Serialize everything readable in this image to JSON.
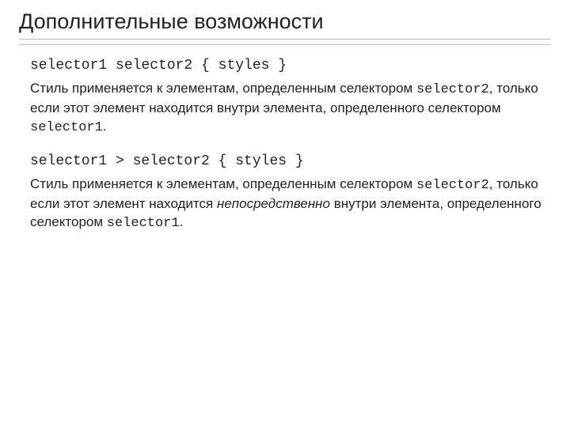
{
  "title": "Дополнительные возможности",
  "sections": [
    {
      "code": "selector1 selector2 { styles }",
      "text": {
        "prefix": "Стиль применяется к элементам, определенным селектором ",
        "sel2": "selector2",
        "mid": ", только если этот элемент находится внутри элемента, определенного селектором ",
        "italic_mid": "",
        "after_italic": "",
        "sel1": "selector1",
        "suffix": "."
      }
    },
    {
      "code": "selector1 > selector2 { styles }",
      "text": {
        "prefix": "Стиль применяется к элементам, определенным селектором ",
        "sel2": "selector2",
        "mid": ", только если этот элемент находится ",
        "italic_mid": "непосредственно",
        "after_italic": " внутри элемента, определенного селектором ",
        "sel1": "selector1",
        "suffix": "."
      }
    }
  ]
}
